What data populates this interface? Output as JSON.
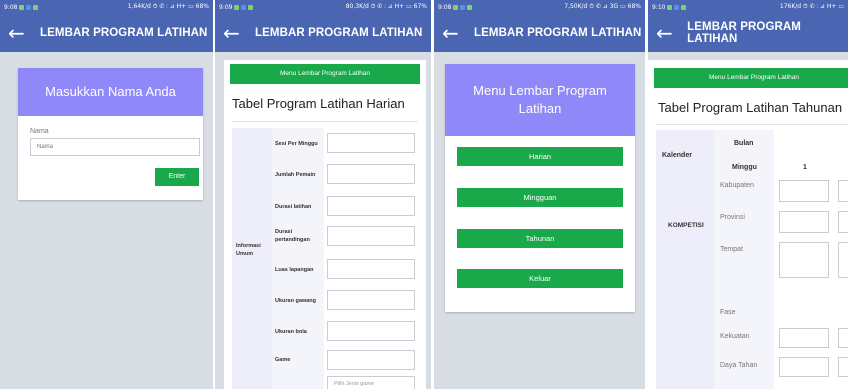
{
  "app_title": "LEMBAR PROGRAM LATIHAN",
  "status": [
    {
      "time": "9:08",
      "right": "1,64K/d ⏱ ✆ ⫶ ⊿ H+ ▭ 68%"
    },
    {
      "time": "9:09",
      "right": "80,3K/d ⏱ ✆ ⫶ ⊿ H+ ▭ 67%"
    },
    {
      "time": "9:08",
      "right": "7,50K/d ⏱ ✆ ⊿ 3G ▭ 68%"
    },
    {
      "time": "9:10",
      "right": "176K/d ⏱ ✆ ⫶ ⊿ H+ ▭"
    }
  ],
  "screen1": {
    "header": "Masukkan Nama Anda",
    "name_label": "Nama",
    "name_placeholder": "Nama",
    "enter": "Enter"
  },
  "screen2": {
    "menu_button": "Menu Lembar Program Latihan",
    "table_title": "Tabel Program Latihan Harian",
    "group_label": "Informasi Umum",
    "rows": [
      "Sesi Per Minggu",
      "Jumlah Pemain",
      "Durasi latihan",
      "Durasi pertandingan",
      "Luas lapangan",
      "Ukuran gawang",
      "Ukuran bola",
      "Game"
    ],
    "select_placeholder": "Pilih Jenis game"
  },
  "screen3": {
    "header": "Menu Lembar Program Latihan",
    "buttons": [
      "Harian",
      "Mingguan",
      "Tahunan",
      "Keluar"
    ]
  },
  "screen4": {
    "menu_button": "Menu Lembar Program Latihan",
    "table_title": "Tabel Program Latihan Tahunan",
    "kalender": "Kalender",
    "bulan": "Bulan",
    "minggu": "Minggu",
    "col1": "1",
    "kompetisi": "KOMPETISI",
    "kompetisi_rows": [
      "Kabupaten",
      "Provinsi",
      "Tempat"
    ],
    "fase": "Fase",
    "lower_rows": [
      "Kekuatan",
      "Daya Tahan"
    ]
  }
}
